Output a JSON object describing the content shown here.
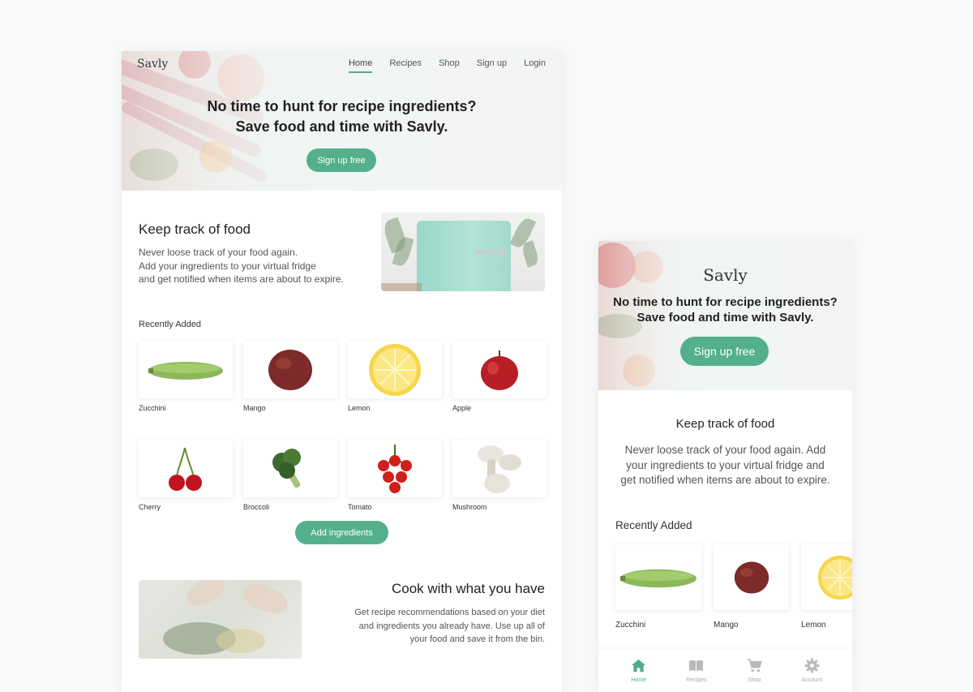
{
  "brand": "Savly",
  "colors": {
    "accent": "#54b08c",
    "background": "#f7f9fb",
    "card": "#ffffff"
  },
  "desktop": {
    "nav": [
      {
        "label": "Home",
        "active": true
      },
      {
        "label": "Recipes"
      },
      {
        "label": "Shop"
      },
      {
        "label": "Sign up"
      },
      {
        "label": "Login"
      }
    ],
    "hero": {
      "title_line1": "No time to hunt for recipe ingredients?",
      "title_line2": "Save food and time with Savly.",
      "cta": "Sign up free"
    },
    "keep_track": {
      "title": "Keep track of food",
      "lines": [
        "Never loose track of your food again.",
        "Add your ingredients to your virtual fridge",
        "and get notified when items are about to expire."
      ]
    },
    "recently_added": {
      "label": "Recently Added",
      "items": [
        "Zucchini",
        "Mango",
        "Lemon",
        "Apple",
        "Cherry",
        "Broccoli",
        "Tomato",
        "Mushroom"
      ]
    },
    "add_button": "Add ingredients",
    "cook": {
      "title": "Cook with what you have",
      "lines": [
        "Get recipe recommendations based on your diet",
        "and ingredients you already have. Use up all of",
        "your food and save it from the bin."
      ]
    }
  },
  "mobile": {
    "logo": "Savly",
    "title_line1": "No time to hunt for recipe ingredients?",
    "title_line2": "Save food and time with Savly.",
    "cta": "Sign up free",
    "keep_title": "Keep track of food",
    "keep_lines": [
      "Never loose track of your food again. Add",
      "your ingredients to your virtual fridge and",
      "get notified when items are about to expire."
    ],
    "recent_label": "Recently Added",
    "items": [
      "Zucchini",
      "Mango",
      "Lemon"
    ],
    "tabs": [
      {
        "label": "Home",
        "icon": "home-icon",
        "active": true
      },
      {
        "label": "Recipes",
        "icon": "book-icon"
      },
      {
        "label": "Shop",
        "icon": "cart-icon"
      },
      {
        "label": "Account",
        "icon": "gear-icon"
      }
    ]
  }
}
